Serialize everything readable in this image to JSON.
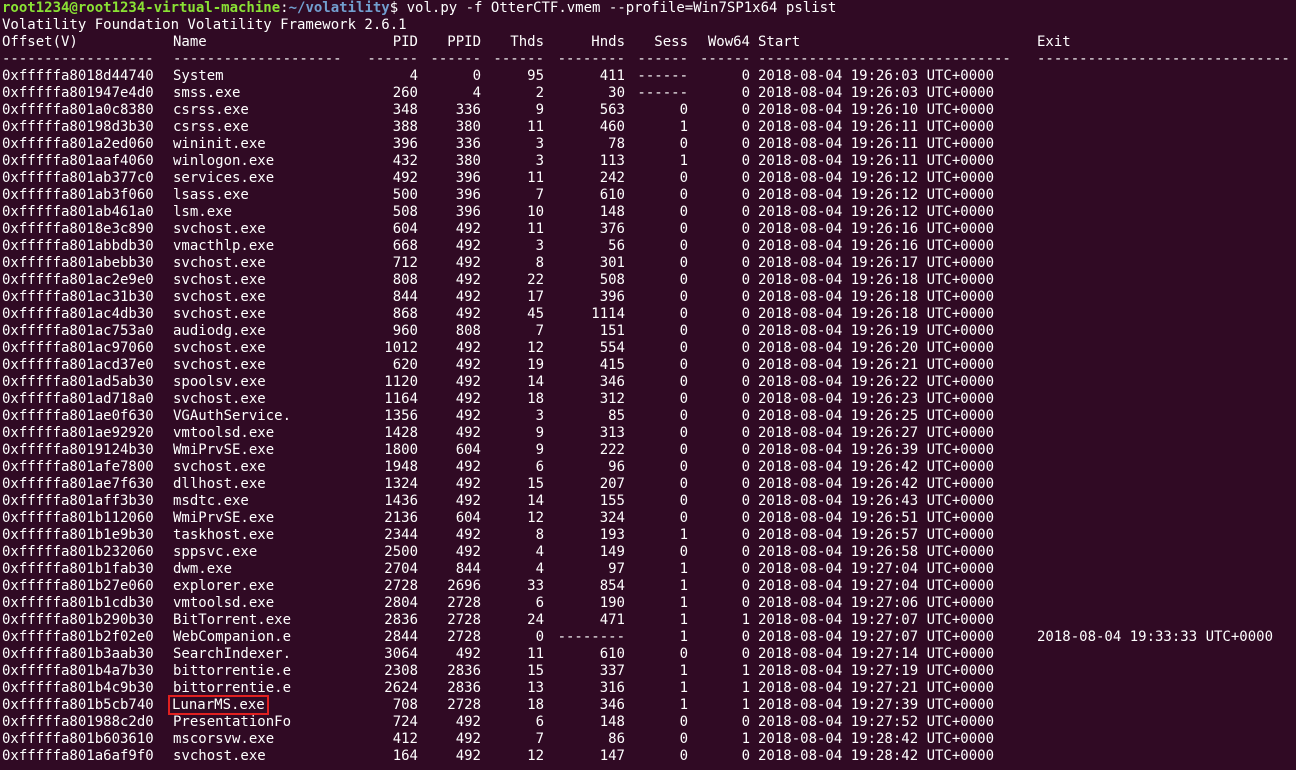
{
  "prompt": {
    "user_host": "root1234@root1234-virtual-machine",
    "separator": ":",
    "path": "~/volatility",
    "symbol": "$ ",
    "command": "vol.py -f OtterCTF.vmem --profile=Win7SP1x64 pslist"
  },
  "banner": "Volatility Foundation Volatility Framework 2.6.1",
  "headers": {
    "offset": "Offset(V)",
    "name": "Name",
    "pid": "PID",
    "ppid": "PPID",
    "thds": "Thds",
    "hnds": "Hnds",
    "sess": "Sess",
    "wow64": "Wow64",
    "start": "Start",
    "exit": "Exit"
  },
  "separators": {
    "offset": "------------------",
    "name": "--------------------",
    "pid": "------",
    "ppid": "------",
    "thds": "------",
    "hnds": "--------",
    "sess": "------",
    "wow64": "------",
    "start": "------------------------------",
    "exit": "------------------------------"
  },
  "highlighted_process": "LunarMS.exe",
  "rows": [
    {
      "offset": "0xfffffa8018d44740",
      "name": "System",
      "pid": "4",
      "ppid": "0",
      "thds": "95",
      "hnds": "411",
      "sess": "------",
      "wow64": "0",
      "start": "2018-08-04 19:26:03 UTC+0000",
      "exit": ""
    },
    {
      "offset": "0xfffffa801947e4d0",
      "name": "smss.exe",
      "pid": "260",
      "ppid": "4",
      "thds": "2",
      "hnds": "30",
      "sess": "------",
      "wow64": "0",
      "start": "2018-08-04 19:26:03 UTC+0000",
      "exit": ""
    },
    {
      "offset": "0xfffffa801a0c8380",
      "name": "csrss.exe",
      "pid": "348",
      "ppid": "336",
      "thds": "9",
      "hnds": "563",
      "sess": "0",
      "wow64": "0",
      "start": "2018-08-04 19:26:10 UTC+0000",
      "exit": ""
    },
    {
      "offset": "0xfffffa80198d3b30",
      "name": "csrss.exe",
      "pid": "388",
      "ppid": "380",
      "thds": "11",
      "hnds": "460",
      "sess": "1",
      "wow64": "0",
      "start": "2018-08-04 19:26:11 UTC+0000",
      "exit": ""
    },
    {
      "offset": "0xfffffa801a2ed060",
      "name": "wininit.exe",
      "pid": "396",
      "ppid": "336",
      "thds": "3",
      "hnds": "78",
      "sess": "0",
      "wow64": "0",
      "start": "2018-08-04 19:26:11 UTC+0000",
      "exit": ""
    },
    {
      "offset": "0xfffffa801aaf4060",
      "name": "winlogon.exe",
      "pid": "432",
      "ppid": "380",
      "thds": "3",
      "hnds": "113",
      "sess": "1",
      "wow64": "0",
      "start": "2018-08-04 19:26:11 UTC+0000",
      "exit": ""
    },
    {
      "offset": "0xfffffa801ab377c0",
      "name": "services.exe",
      "pid": "492",
      "ppid": "396",
      "thds": "11",
      "hnds": "242",
      "sess": "0",
      "wow64": "0",
      "start": "2018-08-04 19:26:12 UTC+0000",
      "exit": ""
    },
    {
      "offset": "0xfffffa801ab3f060",
      "name": "lsass.exe",
      "pid": "500",
      "ppid": "396",
      "thds": "7",
      "hnds": "610",
      "sess": "0",
      "wow64": "0",
      "start": "2018-08-04 19:26:12 UTC+0000",
      "exit": ""
    },
    {
      "offset": "0xfffffa801ab461a0",
      "name": "lsm.exe",
      "pid": "508",
      "ppid": "396",
      "thds": "10",
      "hnds": "148",
      "sess": "0",
      "wow64": "0",
      "start": "2018-08-04 19:26:12 UTC+0000",
      "exit": ""
    },
    {
      "offset": "0xfffffa8018e3c890",
      "name": "svchost.exe",
      "pid": "604",
      "ppid": "492",
      "thds": "11",
      "hnds": "376",
      "sess": "0",
      "wow64": "0",
      "start": "2018-08-04 19:26:16 UTC+0000",
      "exit": ""
    },
    {
      "offset": "0xfffffa801abbdb30",
      "name": "vmacthlp.exe",
      "pid": "668",
      "ppid": "492",
      "thds": "3",
      "hnds": "56",
      "sess": "0",
      "wow64": "0",
      "start": "2018-08-04 19:26:16 UTC+0000",
      "exit": ""
    },
    {
      "offset": "0xfffffa801abebb30",
      "name": "svchost.exe",
      "pid": "712",
      "ppid": "492",
      "thds": "8",
      "hnds": "301",
      "sess": "0",
      "wow64": "0",
      "start": "2018-08-04 19:26:17 UTC+0000",
      "exit": ""
    },
    {
      "offset": "0xfffffa801ac2e9e0",
      "name": "svchost.exe",
      "pid": "808",
      "ppid": "492",
      "thds": "22",
      "hnds": "508",
      "sess": "0",
      "wow64": "0",
      "start": "2018-08-04 19:26:18 UTC+0000",
      "exit": ""
    },
    {
      "offset": "0xfffffa801ac31b30",
      "name": "svchost.exe",
      "pid": "844",
      "ppid": "492",
      "thds": "17",
      "hnds": "396",
      "sess": "0",
      "wow64": "0",
      "start": "2018-08-04 19:26:18 UTC+0000",
      "exit": ""
    },
    {
      "offset": "0xfffffa801ac4db30",
      "name": "svchost.exe",
      "pid": "868",
      "ppid": "492",
      "thds": "45",
      "hnds": "1114",
      "sess": "0",
      "wow64": "0",
      "start": "2018-08-04 19:26:18 UTC+0000",
      "exit": ""
    },
    {
      "offset": "0xfffffa801ac753a0",
      "name": "audiodg.exe",
      "pid": "960",
      "ppid": "808",
      "thds": "7",
      "hnds": "151",
      "sess": "0",
      "wow64": "0",
      "start": "2018-08-04 19:26:19 UTC+0000",
      "exit": ""
    },
    {
      "offset": "0xfffffa801ac97060",
      "name": "svchost.exe",
      "pid": "1012",
      "ppid": "492",
      "thds": "12",
      "hnds": "554",
      "sess": "0",
      "wow64": "0",
      "start": "2018-08-04 19:26:20 UTC+0000",
      "exit": ""
    },
    {
      "offset": "0xfffffa801acd37e0",
      "name": "svchost.exe",
      "pid": "620",
      "ppid": "492",
      "thds": "19",
      "hnds": "415",
      "sess": "0",
      "wow64": "0",
      "start": "2018-08-04 19:26:21 UTC+0000",
      "exit": ""
    },
    {
      "offset": "0xfffffa801ad5ab30",
      "name": "spoolsv.exe",
      "pid": "1120",
      "ppid": "492",
      "thds": "14",
      "hnds": "346",
      "sess": "0",
      "wow64": "0",
      "start": "2018-08-04 19:26:22 UTC+0000",
      "exit": ""
    },
    {
      "offset": "0xfffffa801ad718a0",
      "name": "svchost.exe",
      "pid": "1164",
      "ppid": "492",
      "thds": "18",
      "hnds": "312",
      "sess": "0",
      "wow64": "0",
      "start": "2018-08-04 19:26:23 UTC+0000",
      "exit": ""
    },
    {
      "offset": "0xfffffa801ae0f630",
      "name": "VGAuthService.",
      "pid": "1356",
      "ppid": "492",
      "thds": "3",
      "hnds": "85",
      "sess": "0",
      "wow64": "0",
      "start": "2018-08-04 19:26:25 UTC+0000",
      "exit": ""
    },
    {
      "offset": "0xfffffa801ae92920",
      "name": "vmtoolsd.exe",
      "pid": "1428",
      "ppid": "492",
      "thds": "9",
      "hnds": "313",
      "sess": "0",
      "wow64": "0",
      "start": "2018-08-04 19:26:27 UTC+0000",
      "exit": ""
    },
    {
      "offset": "0xfffffa8019124b30",
      "name": "WmiPrvSE.exe",
      "pid": "1800",
      "ppid": "604",
      "thds": "9",
      "hnds": "222",
      "sess": "0",
      "wow64": "0",
      "start": "2018-08-04 19:26:39 UTC+0000",
      "exit": ""
    },
    {
      "offset": "0xfffffa801afe7800",
      "name": "svchost.exe",
      "pid": "1948",
      "ppid": "492",
      "thds": "6",
      "hnds": "96",
      "sess": "0",
      "wow64": "0",
      "start": "2018-08-04 19:26:42 UTC+0000",
      "exit": ""
    },
    {
      "offset": "0xfffffa801ae7f630",
      "name": "dllhost.exe",
      "pid": "1324",
      "ppid": "492",
      "thds": "15",
      "hnds": "207",
      "sess": "0",
      "wow64": "0",
      "start": "2018-08-04 19:26:42 UTC+0000",
      "exit": ""
    },
    {
      "offset": "0xfffffa801aff3b30",
      "name": "msdtc.exe",
      "pid": "1436",
      "ppid": "492",
      "thds": "14",
      "hnds": "155",
      "sess": "0",
      "wow64": "0",
      "start": "2018-08-04 19:26:43 UTC+0000",
      "exit": ""
    },
    {
      "offset": "0xfffffa801b112060",
      "name": "WmiPrvSE.exe",
      "pid": "2136",
      "ppid": "604",
      "thds": "12",
      "hnds": "324",
      "sess": "0",
      "wow64": "0",
      "start": "2018-08-04 19:26:51 UTC+0000",
      "exit": ""
    },
    {
      "offset": "0xfffffa801b1e9b30",
      "name": "taskhost.exe",
      "pid": "2344",
      "ppid": "492",
      "thds": "8",
      "hnds": "193",
      "sess": "1",
      "wow64": "0",
      "start": "2018-08-04 19:26:57 UTC+0000",
      "exit": ""
    },
    {
      "offset": "0xfffffa801b232060",
      "name": "sppsvc.exe",
      "pid": "2500",
      "ppid": "492",
      "thds": "4",
      "hnds": "149",
      "sess": "0",
      "wow64": "0",
      "start": "2018-08-04 19:26:58 UTC+0000",
      "exit": ""
    },
    {
      "offset": "0xfffffa801b1fab30",
      "name": "dwm.exe",
      "pid": "2704",
      "ppid": "844",
      "thds": "4",
      "hnds": "97",
      "sess": "1",
      "wow64": "0",
      "start": "2018-08-04 19:27:04 UTC+0000",
      "exit": ""
    },
    {
      "offset": "0xfffffa801b27e060",
      "name": "explorer.exe",
      "pid": "2728",
      "ppid": "2696",
      "thds": "33",
      "hnds": "854",
      "sess": "1",
      "wow64": "0",
      "start": "2018-08-04 19:27:04 UTC+0000",
      "exit": ""
    },
    {
      "offset": "0xfffffa801b1cdb30",
      "name": "vmtoolsd.exe",
      "pid": "2804",
      "ppid": "2728",
      "thds": "6",
      "hnds": "190",
      "sess": "1",
      "wow64": "0",
      "start": "2018-08-04 19:27:06 UTC+0000",
      "exit": ""
    },
    {
      "offset": "0xfffffa801b290b30",
      "name": "BitTorrent.exe",
      "pid": "2836",
      "ppid": "2728",
      "thds": "24",
      "hnds": "471",
      "sess": "1",
      "wow64": "1",
      "start": "2018-08-04 19:27:07 UTC+0000",
      "exit": ""
    },
    {
      "offset": "0xfffffa801b2f02e0",
      "name": "WebCompanion.e",
      "pid": "2844",
      "ppid": "2728",
      "thds": "0",
      "hnds": "--------",
      "sess": "1",
      "wow64": "0",
      "start": "2018-08-04 19:27:07 UTC+0000",
      "exit": "2018-08-04 19:33:33 UTC+0000"
    },
    {
      "offset": "0xfffffa801b3aab30",
      "name": "SearchIndexer.",
      "pid": "3064",
      "ppid": "492",
      "thds": "11",
      "hnds": "610",
      "sess": "0",
      "wow64": "0",
      "start": "2018-08-04 19:27:14 UTC+0000",
      "exit": ""
    },
    {
      "offset": "0xfffffa801b4a7b30",
      "name": "bittorrentie.e",
      "pid": "2308",
      "ppid": "2836",
      "thds": "15",
      "hnds": "337",
      "sess": "1",
      "wow64": "1",
      "start": "2018-08-04 19:27:19 UTC+0000",
      "exit": ""
    },
    {
      "offset": "0xfffffa801b4c9b30",
      "name": "bittorrentie.e",
      "pid": "2624",
      "ppid": "2836",
      "thds": "13",
      "hnds": "316",
      "sess": "1",
      "wow64": "1",
      "start": "2018-08-04 19:27:21 UTC+0000",
      "exit": ""
    },
    {
      "offset": "0xfffffa801b5cb740",
      "name": "LunarMS.exe",
      "pid": "708",
      "ppid": "2728",
      "thds": "18",
      "hnds": "346",
      "sess": "1",
      "wow64": "1",
      "start": "2018-08-04 19:27:39 UTC+0000",
      "exit": ""
    },
    {
      "offset": "0xfffffa801988c2d0",
      "name": "PresentationFo",
      "pid": "724",
      "ppid": "492",
      "thds": "6",
      "hnds": "148",
      "sess": "0",
      "wow64": "0",
      "start": "2018-08-04 19:27:52 UTC+0000",
      "exit": ""
    },
    {
      "offset": "0xfffffa801b603610",
      "name": "mscorsvw.exe",
      "pid": "412",
      "ppid": "492",
      "thds": "7",
      "hnds": "86",
      "sess": "0",
      "wow64": "1",
      "start": "2018-08-04 19:28:42 UTC+0000",
      "exit": ""
    },
    {
      "offset": "0xfffffa801a6af9f0",
      "name": "svchost.exe",
      "pid": "164",
      "ppid": "492",
      "thds": "12",
      "hnds": "147",
      "sess": "0",
      "wow64": "0",
      "start": "2018-08-04 19:28:42 UTC+0000",
      "exit": ""
    }
  ]
}
